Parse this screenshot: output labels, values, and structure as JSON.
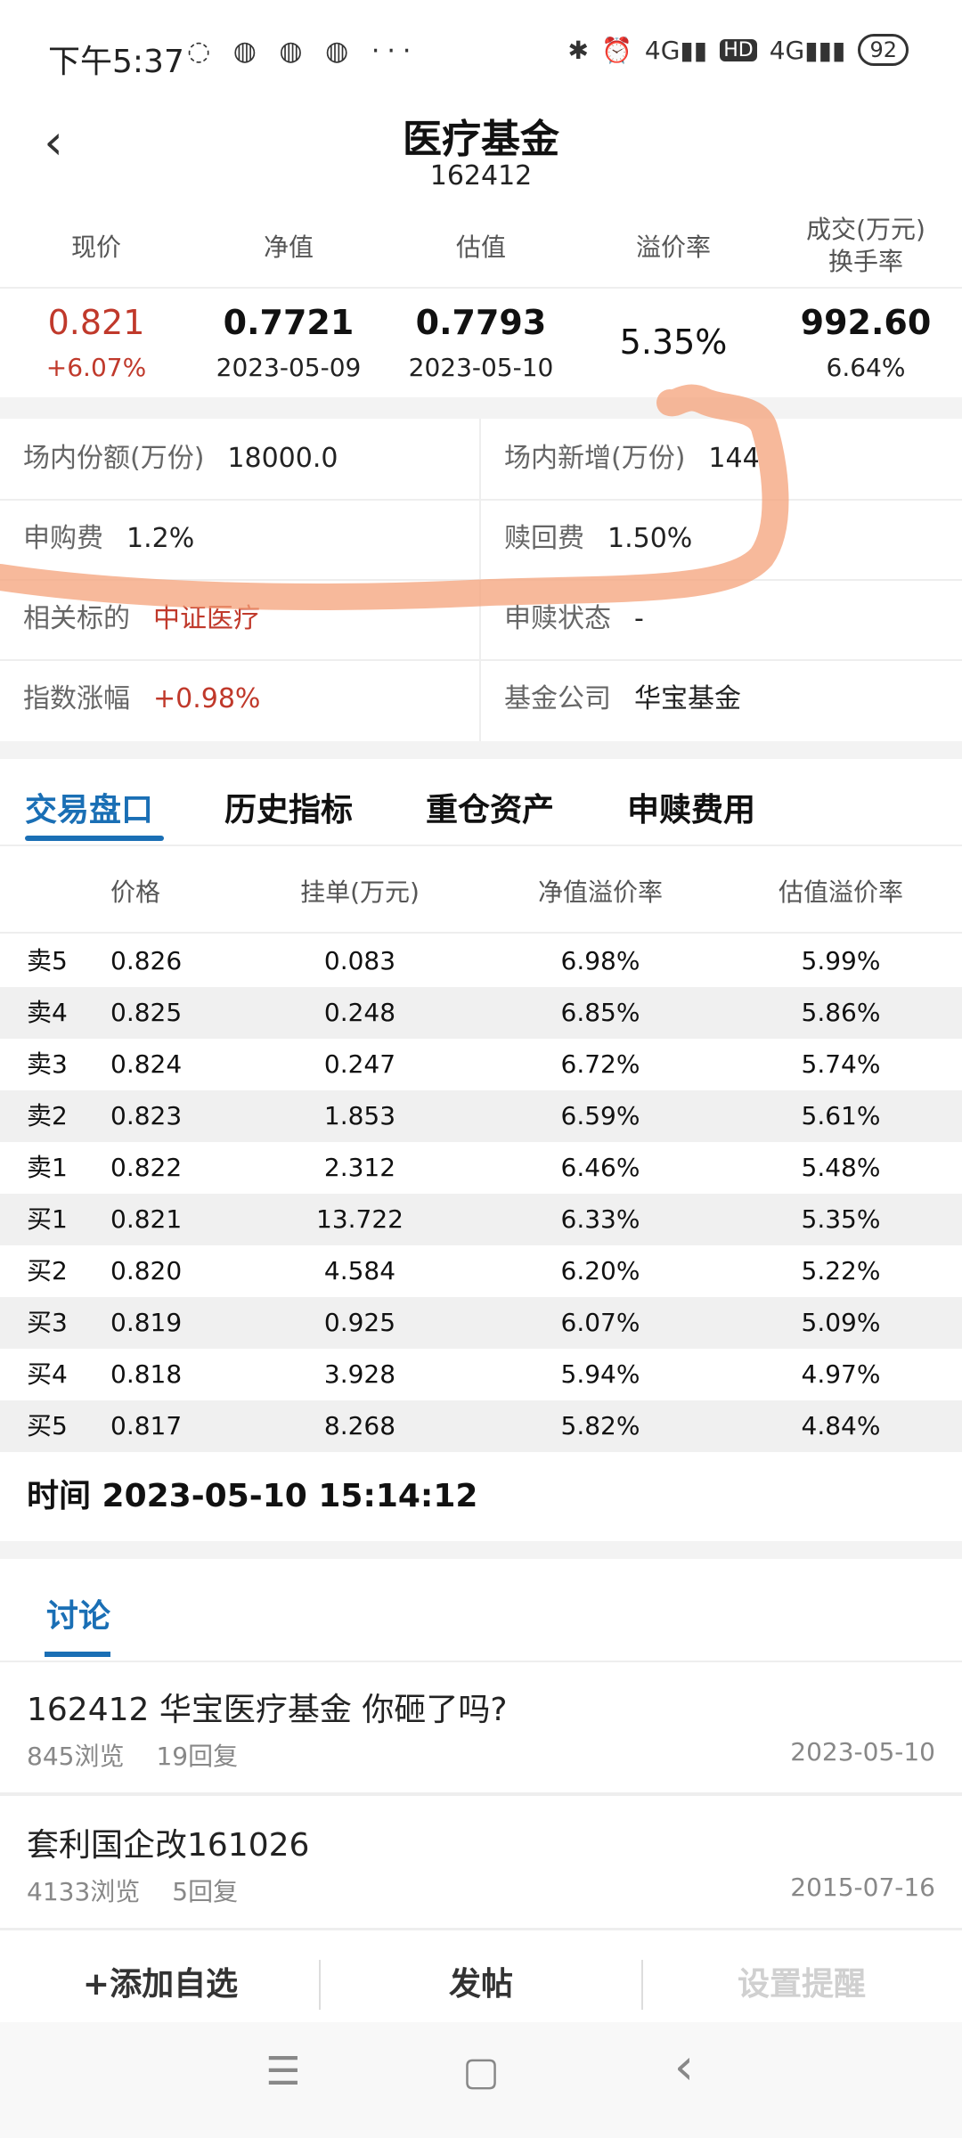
{
  "status_bar": {
    "time": "下午5:37",
    "icons": "◌ ◍ ◍ ◍ ···",
    "bt": "✱",
    "alarm": "⏰",
    "net1": "4G▮▮",
    "hd": "HD",
    "net2": "4G▮▮▮",
    "battery": "92"
  },
  "header": {
    "title": "医疗基金",
    "code": "162412"
  },
  "quote": {
    "headers": [
      "现价",
      "净值",
      "估值",
      "溢价率",
      "成交(万元)",
      "换手率"
    ],
    "price": "0.821",
    "price_change": "+6.07%",
    "nav": "0.7721",
    "nav_date": "2023-05-09",
    "est": "0.7793",
    "est_date": "2023-05-10",
    "premium": "5.35%",
    "volume": "992.60",
    "turnover": "6.64%"
  },
  "info": {
    "shares_label": "场内份额(万份)",
    "shares_value": "18000.0",
    "new_label": "场内新增(万份)",
    "new_value": "144",
    "purchase_label": "申购费",
    "purchase_value": "1.2%",
    "redeem_label": "赎回费",
    "redeem_value": "1.50%",
    "target_label": "相关标的",
    "target_value": "中证医疗",
    "status_label": "申赎状态",
    "status_value": "-",
    "index_label": "指数涨幅",
    "index_value": "+0.98%",
    "company_label": "基金公司",
    "company_value": "华宝基金"
  },
  "tabs": [
    "交易盘口",
    "历史指标",
    "重仓资产",
    "申赎费用"
  ],
  "orderbook": {
    "headers": [
      "价格",
      "挂单(万元)",
      "净值溢价率",
      "估值溢价率"
    ],
    "rows": [
      {
        "label": "卖5",
        "price": "0.826",
        "amount": "0.083",
        "nav_prem": "6.98%",
        "est_prem": "5.99%"
      },
      {
        "label": "卖4",
        "price": "0.825",
        "amount": "0.248",
        "nav_prem": "6.85%",
        "est_prem": "5.86%"
      },
      {
        "label": "卖3",
        "price": "0.824",
        "amount": "0.247",
        "nav_prem": "6.72%",
        "est_prem": "5.74%"
      },
      {
        "label": "卖2",
        "price": "0.823",
        "amount": "1.853",
        "nav_prem": "6.59%",
        "est_prem": "5.61%"
      },
      {
        "label": "卖1",
        "price": "0.822",
        "amount": "2.312",
        "nav_prem": "6.46%",
        "est_prem": "5.48%"
      },
      {
        "label": "买1",
        "price": "0.821",
        "amount": "13.722",
        "nav_prem": "6.33%",
        "est_prem": "5.35%"
      },
      {
        "label": "买2",
        "price": "0.820",
        "amount": "4.584",
        "nav_prem": "6.20%",
        "est_prem": "5.22%"
      },
      {
        "label": "买3",
        "price": "0.819",
        "amount": "0.925",
        "nav_prem": "6.07%",
        "est_prem": "5.09%"
      },
      {
        "label": "买4",
        "price": "0.818",
        "amount": "3.928",
        "nav_prem": "5.94%",
        "est_prem": "4.97%"
      },
      {
        "label": "买5",
        "price": "0.817",
        "amount": "8.268",
        "nav_prem": "5.82%",
        "est_prem": "4.84%"
      }
    ],
    "time": "时间 2023-05-10 15:14:12"
  },
  "discussion": {
    "tab": "讨论",
    "posts": [
      {
        "title": "162412 华宝医疗基金 你砸了吗?",
        "views": "845浏览",
        "replies": "19回复",
        "date": "2023-05-10"
      },
      {
        "title": "套利国企改161026",
        "views": "4133浏览",
        "replies": "5回复",
        "date": "2015-07-16"
      }
    ]
  },
  "actions": {
    "add": "+添加自选",
    "post": "发帖",
    "alert": "设置提醒"
  },
  "nav": {
    "menu": "☰",
    "home": "▢",
    "back": "‹"
  },
  "colors": {
    "accent": "#1a6fb5",
    "up": "#c0392b",
    "annotation": "#f4a27a"
  }
}
